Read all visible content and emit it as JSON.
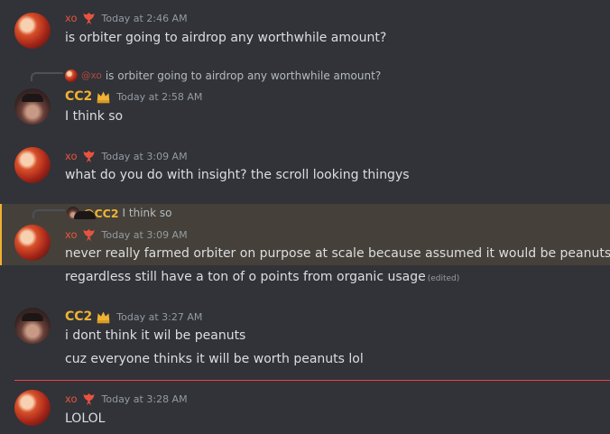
{
  "messages": [
    {
      "author": "xo",
      "timestamp": "Today at 2:46 AM",
      "lines": [
        "is orbiter going to airdrop any worthwhile amount?"
      ]
    },
    {
      "author": "CC2",
      "timestamp": "Today at 2:58 AM",
      "reply": {
        "author": "@xo",
        "text": "is orbiter going to airdrop any worthwhile amount?"
      },
      "lines": [
        "I think so"
      ]
    },
    {
      "author": "xo",
      "timestamp": "Today at 3:09 AM",
      "lines": [
        "what do you do with insight? the scroll looking thingys"
      ]
    },
    {
      "author": "xo",
      "timestamp": "Today at 3:09 AM",
      "reply": {
        "author": "@CC2",
        "text": "I think so"
      },
      "lines": [
        "never really farmed orbiter on purpose at scale because assumed it would be peanuts",
        "regardless still have a ton of o points from organic usage"
      ],
      "edited": "(edited)"
    },
    {
      "author": "CC2",
      "timestamp": "Today at 3:27 AM",
      "lines": [
        "i dont think it wil be peanuts",
        "cuz everyone thinks it will be worth peanuts lol"
      ]
    },
    {
      "author": "xo",
      "timestamp": "Today at 3:28 AM",
      "lines": [
        "LOLOL"
      ]
    }
  ],
  "colors": {
    "background": "#313338",
    "mention_highlight": "#45413a",
    "mention_bar": "#f0b232",
    "xo_name": "#e8533f",
    "cc2_name": "#f0b232",
    "new_messages_divider": "#f23f42"
  },
  "icons": {
    "xo_badge": "fire-phoenix-icon",
    "cc2_badge": "crown-icon"
  }
}
